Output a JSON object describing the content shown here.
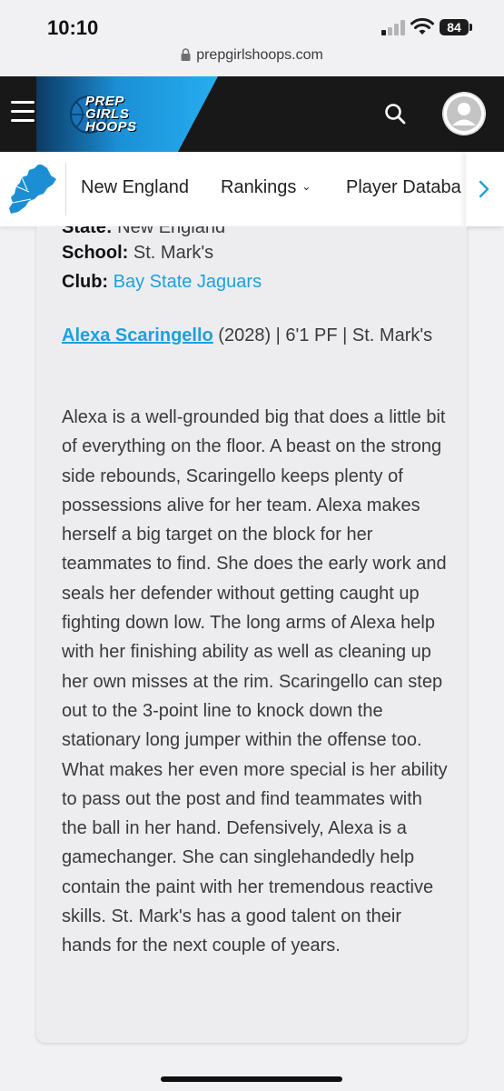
{
  "status_bar": {
    "time": "10:10",
    "battery": "84"
  },
  "browser": {
    "url": "prepgirlshoops.com"
  },
  "header": {
    "logo_lines": [
      "PREP",
      "GIRLS",
      "HOOPS"
    ]
  },
  "nav": {
    "items": [
      "New England",
      "Rankings",
      "Player Databa"
    ]
  },
  "article": {
    "state_label": "State:",
    "state_value": "New England",
    "school_label": "School:",
    "school_value": "St. Mark's",
    "club_label": "Club:",
    "club_value": "Bay State Jaguars",
    "player_name": "Alexa Scaringello",
    "player_details": " (2028) | 6'1 PF | St. Mark's",
    "bio": "Alexa is a well-grounded big that does a little bit of everything on the floor. A beast on the strong side rebounds, Scaringello keeps plenty of possessions alive for her team. Alexa makes herself a big target on the block for her teammates to find. She does the early work and seals her defender without getting caught up fighting down low. The long arms of Alexa help with her finishing ability as well as cleaning up her own misses at the rim. Scaringello can step out to the 3-point line to knock down the stationary long jumper within the offense too. What makes her even more special is her ability to pass out the post and find teammates with the ball in her hand. Defensively, Alexa is a gamechanger. She can singlehandedly help contain the paint with her tremendous reactive skills. St. Mark's has a good talent on their hands for the next couple of years."
  },
  "icons": {
    "menu": "hamburger-icon",
    "search": "search-icon",
    "avatar": "user-avatar-icon",
    "scroll": "chevron-right-icon",
    "lock": "lock-icon"
  },
  "colors": {
    "accent": "#1da0de",
    "header_bg": "#181818"
  }
}
